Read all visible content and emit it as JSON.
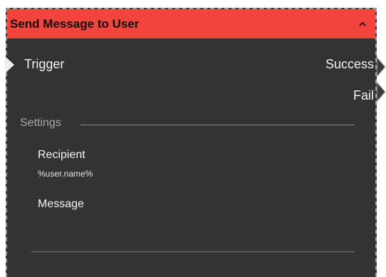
{
  "node": {
    "title": "Send Message to User",
    "header_color": "#f2433c",
    "collapse_icon": "chevron-up-icon"
  },
  "ports": {
    "input": "Trigger",
    "outputs": [
      "Success",
      "Fail"
    ]
  },
  "settings": {
    "section_title": "Settings",
    "fields": [
      {
        "label": "Recipient",
        "value": "%user.name%"
      },
      {
        "label": "Message",
        "value": ""
      }
    ]
  }
}
